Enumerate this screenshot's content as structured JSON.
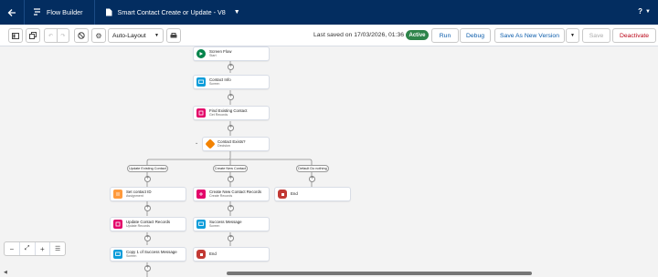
{
  "header": {
    "back_icon": "arrow-left",
    "app_name": "Flow Builder",
    "flow_title": "Smart Contact Create or Update - V8",
    "help": "?"
  },
  "toolbar": {
    "layout_mode": "Auto-Layout",
    "saved_text": "Last saved on 17/03/2026, 01:36",
    "status": "Active",
    "run": "Run",
    "debug": "Debug",
    "save_as": "Save As New Version",
    "save": "Save",
    "deactivate": "Deactivate"
  },
  "nodes": {
    "screen_flow": {
      "title": "Screen Flow",
      "sub": "Start"
    },
    "contact_info": {
      "title": "Contact Info",
      "sub": "Screen"
    },
    "find_contact": {
      "title": "Find Existing Contact",
      "sub": "Get Records"
    },
    "contact_exists": {
      "title": "Contact Exists?",
      "sub": "Decision"
    },
    "set_contact_id": {
      "title": "Set contact ID",
      "sub": "Assignment"
    },
    "create_contact": {
      "title": "Create New Contact Records",
      "sub": "Create Records"
    },
    "end_right": {
      "title": "End"
    },
    "update_contact": {
      "title": "Update Contact Records",
      "sub": "Update Records"
    },
    "success_message": {
      "title": "Success Message",
      "sub": "Screen"
    },
    "copy_success": {
      "title": "Copy 1 of Success Message",
      "sub": "Screen"
    },
    "end_middle": {
      "title": "End"
    }
  },
  "branches": {
    "update": "Update Existing Contact",
    "create": "Create New Contact",
    "default": "Default Do nothing"
  },
  "colors": {
    "header_bg": "#032d60",
    "active_green": "#2e844a",
    "screen_blue": "#0d9dda",
    "record_pink": "#e3066a",
    "decision_orange": "#f38303",
    "end_red": "#c23934",
    "start_green": "#04844b",
    "assignment_orange": "#ff9a3c"
  }
}
